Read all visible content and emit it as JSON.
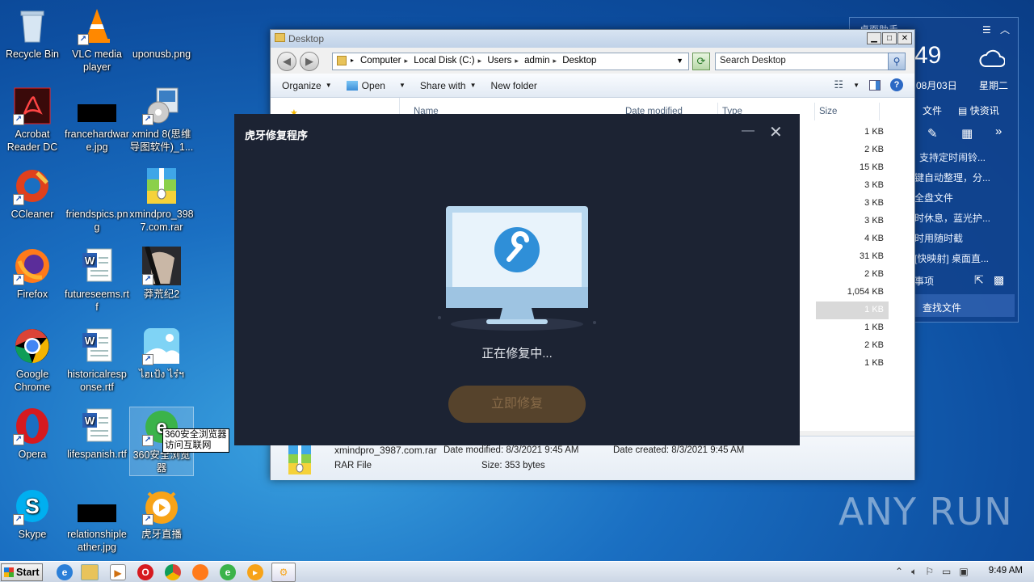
{
  "desktop_icons": [
    {
      "id": "recycle-bin",
      "label": "Recycle Bin"
    },
    {
      "id": "vlc",
      "label": "VLC media player"
    },
    {
      "id": "uponusb",
      "label": "uponusb.png"
    },
    {
      "id": "acrobat",
      "label": "Acrobat Reader DC"
    },
    {
      "id": "francehardware",
      "label": "francehardware.jpg"
    },
    {
      "id": "xmind8",
      "label": "xmind 8(思维导图软件)_1..."
    },
    {
      "id": "ccleaner",
      "label": "CCleaner"
    },
    {
      "id": "friendspics",
      "label": "friendspics.png"
    },
    {
      "id": "xmindpro",
      "label": "xmindpro_3987.com.rar"
    },
    {
      "id": "firefox",
      "label": "Firefox"
    },
    {
      "id": "futureseems",
      "label": "futureseems.rtf"
    },
    {
      "id": "manghuang",
      "label": "莽荒纪2"
    },
    {
      "id": "chrome",
      "label": "Google Chrome"
    },
    {
      "id": "historicalresponse",
      "label": "historicalresponse.rtf"
    },
    {
      "id": "thai-photo",
      "label": "ไฮเป้ง ไร๋ฯ"
    },
    {
      "id": "opera",
      "label": "Opera"
    },
    {
      "id": "lifespanish",
      "label": "lifespanish.rtf"
    },
    {
      "id": "browser360",
      "label": "360安全浏览器"
    },
    {
      "id": "skype",
      "label": "Skype"
    },
    {
      "id": "relationshipleather",
      "label": "relationshipleather.jpg"
    },
    {
      "id": "huya",
      "label": "虎牙直播"
    }
  ],
  "tooltip": {
    "line1": "360安全浏览器",
    "line2": "访问互联网"
  },
  "explorer": {
    "title": "Desktop",
    "breadcrumbs": [
      "Computer",
      "Local Disk (C:)",
      "Users",
      "admin",
      "Desktop"
    ],
    "search_placeholder": "Search Desktop",
    "toolbar": {
      "organize": "Organize",
      "open": "Open",
      "share_with": "Share with",
      "new_folder": "New folder"
    },
    "columns": {
      "name": "Name",
      "date_modified": "Date modified",
      "type": "Type",
      "size": "Size"
    },
    "sizes": [
      "1 KB",
      "2 KB",
      "15 KB",
      "3 KB",
      "3 KB",
      "3 KB",
      "4 KB",
      "31 KB",
      "2 KB",
      "1,054 KB",
      "1 KB",
      "1 KB",
      "2 KB",
      "1 KB"
    ],
    "details": {
      "filename": "xmindpro_3987.com.rar",
      "date_modified": "Date modified: 8/3/2021 9:45 AM",
      "date_created": "Date created: 8/3/2021 9:45 AM",
      "file_type": "RAR File",
      "size": "Size: 353 bytes"
    }
  },
  "gadget": {
    "title": "桌面助手",
    "time_partial": "49",
    "date": "08月03日",
    "weekday": "星期二",
    "tab_file": "文件",
    "tab_news": "快资讯",
    "items": [
      "支持定时闹铃...",
      "键自动整理，分...",
      "全盘文件",
      "时休息，蓝光护...",
      "时用随时截",
      "[快映射] 桌面直...",
      "事项"
    ],
    "find_file": "查找文件"
  },
  "dialog": {
    "title": "虎牙修复程序",
    "status": "正在修复中...",
    "button": "立即修复"
  },
  "watermark": "ANY RUN",
  "taskbar": {
    "start": "Start",
    "time": "9:49 AM"
  }
}
